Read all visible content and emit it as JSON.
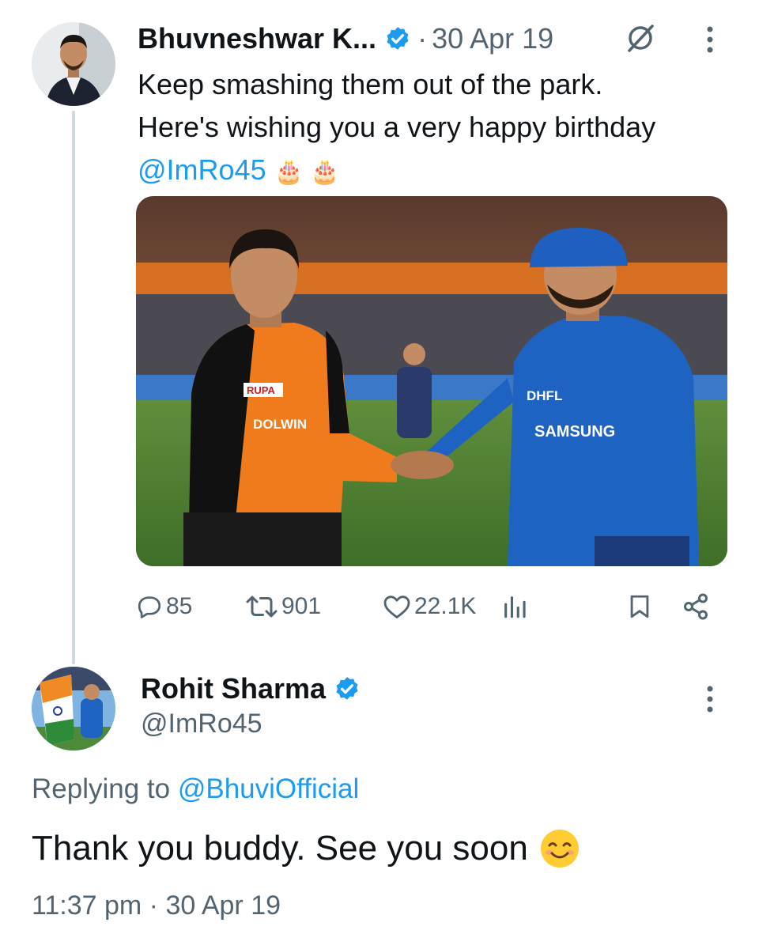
{
  "tweet": {
    "author_name": "Bhuvneshwar K...",
    "dot": "·",
    "date": "30 Apr 19",
    "text_line1": "Keep smashing them out of the park.",
    "text_line2": "Here's wishing you a very happy birthday",
    "mention": "@ImRo45",
    "emoji": "🎂 🎂",
    "actions": {
      "replies": "85",
      "retweets": "901",
      "likes": "22.1K"
    }
  },
  "reply": {
    "author_name": "Rohit Sharma",
    "handle": "@ImRo45",
    "replying_prefix": "Replying to ",
    "replying_to": "@BhuviOfficial",
    "text": "Thank you buddy. See you soon",
    "timestamp": "11:37 pm · 30 Apr 19"
  },
  "media": {
    "left_jersey_texts": [
      "RUPA",
      "DOLWIN"
    ],
    "right_jersey_texts": [
      "DHFL",
      "SAMSUNG"
    ]
  },
  "icons": [
    "verified-badge-icon",
    "grok-icon",
    "more-icon",
    "reply-icon",
    "retweet-icon",
    "like-icon",
    "views-icon",
    "bookmark-icon",
    "share-icon",
    "smile-emoji-icon"
  ],
  "colors": {
    "accent": "#1d9bf0",
    "muted": "#536471",
    "text": "#0f1419",
    "thread": "#cfd9de"
  }
}
